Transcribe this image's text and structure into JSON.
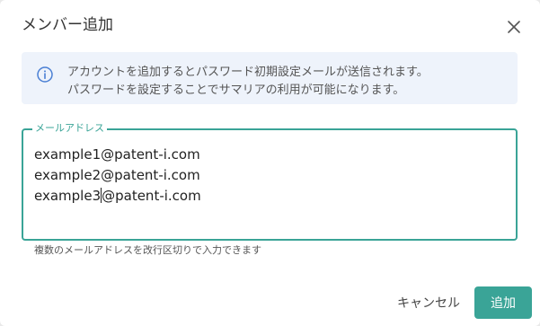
{
  "dialog": {
    "title": "メンバー追加",
    "close_icon": "close-icon"
  },
  "info": {
    "icon": "info-icon",
    "line1": "アカウントを追加するとパスワード初期設定メールが送信されます。",
    "line2": "パスワードを設定することでサマリアの利用が可能になります。"
  },
  "email_field": {
    "label": "メールアドレス",
    "lines": [
      "example1@patent-i.com",
      "example2@patent-i.com"
    ],
    "line3_before_caret": "example3",
    "line3_after_caret": "@patent-i.com",
    "helper": "複数のメールアドレスを改行区切りで入力できます"
  },
  "actions": {
    "cancel_label": "キャンセル",
    "add_label": "追加"
  },
  "colors": {
    "accent": "#3aa497",
    "info_bg": "#eef3fb",
    "info_icon": "#4a7fd4"
  }
}
